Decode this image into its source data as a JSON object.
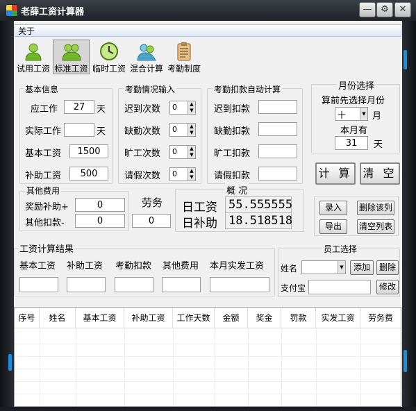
{
  "window": {
    "title": "老薛工资计算器"
  },
  "menu": {
    "about": "关于"
  },
  "toolbar": [
    {
      "label": "试用工资",
      "icon": "user-icon",
      "selected": false
    },
    {
      "label": "标准工资",
      "icon": "users-icon",
      "selected": true
    },
    {
      "label": "临时工资",
      "icon": "clock-icon",
      "selected": false
    },
    {
      "label": "混合计算",
      "icon": "people-icon",
      "selected": false
    },
    {
      "label": "考勤制度",
      "icon": "clipboard-icon",
      "selected": false
    }
  ],
  "basic": {
    "title": "基本信息",
    "workdays_label": "应工作",
    "workdays_value": "27",
    "workdays_unit": "天",
    "actual_label": "实际工作",
    "actual_value": "",
    "actual_unit": "天",
    "base_label": "基本工资",
    "base_value": "1500",
    "subsidy_label": "补助工资",
    "subsidy_value": "500"
  },
  "attendance": {
    "title": "考勤情况输入",
    "late_label": "迟到次数",
    "late_value": "0",
    "absent_label": "缺勤次数",
    "absent_value": "0",
    "truant_label": "旷工次数",
    "truant_value": "0",
    "leave_label": "请假次数",
    "leave_value": "0"
  },
  "deduct": {
    "title": "考勤扣款自动计算",
    "late_label": "迟到扣款",
    "absent_label": "缺勤扣款",
    "truant_label": "旷工扣款",
    "leave_label": "请假扣款"
  },
  "month": {
    "title": "月份选择",
    "hint": "算前先选择月份",
    "month_value": "十",
    "month_unit": "月",
    "days_label": "本月有",
    "days_value": "31",
    "days_unit": "天"
  },
  "actions": {
    "calc": "计 算",
    "clear": "清 空"
  },
  "other": {
    "title": "其他费用",
    "bonus_label": "奖励补助+",
    "bonus_value": "0",
    "deduct_label": "其他扣款-",
    "deduct_value": "0",
    "labor_label": "劳务",
    "labor_value": "0"
  },
  "overview": {
    "title": "概 况",
    "daily_label": "日工资",
    "daily_value": "55.555555",
    "daily_sub_label": "日补助",
    "daily_sub_value": "18.518518"
  },
  "records": {
    "enter": "录入",
    "delete_row": "删除该列",
    "export": "导出",
    "clear_list": "清空列表"
  },
  "result": {
    "title": "工资计算结果",
    "cols": [
      "基本工资",
      "补助工资",
      "考勤扣款",
      "其他费用",
      "本月实发工资"
    ]
  },
  "employee": {
    "title": "员工选择",
    "name_label": "姓名",
    "add": "添加",
    "delete": "删除",
    "alipay_label": "支付宝",
    "modify": "修改"
  },
  "table": {
    "columns": [
      "序号",
      "姓名",
      "基本工资",
      "补助工资",
      "工作天数",
      "金额",
      "奖金",
      "罚款",
      "实发工资",
      "劳务费"
    ]
  }
}
